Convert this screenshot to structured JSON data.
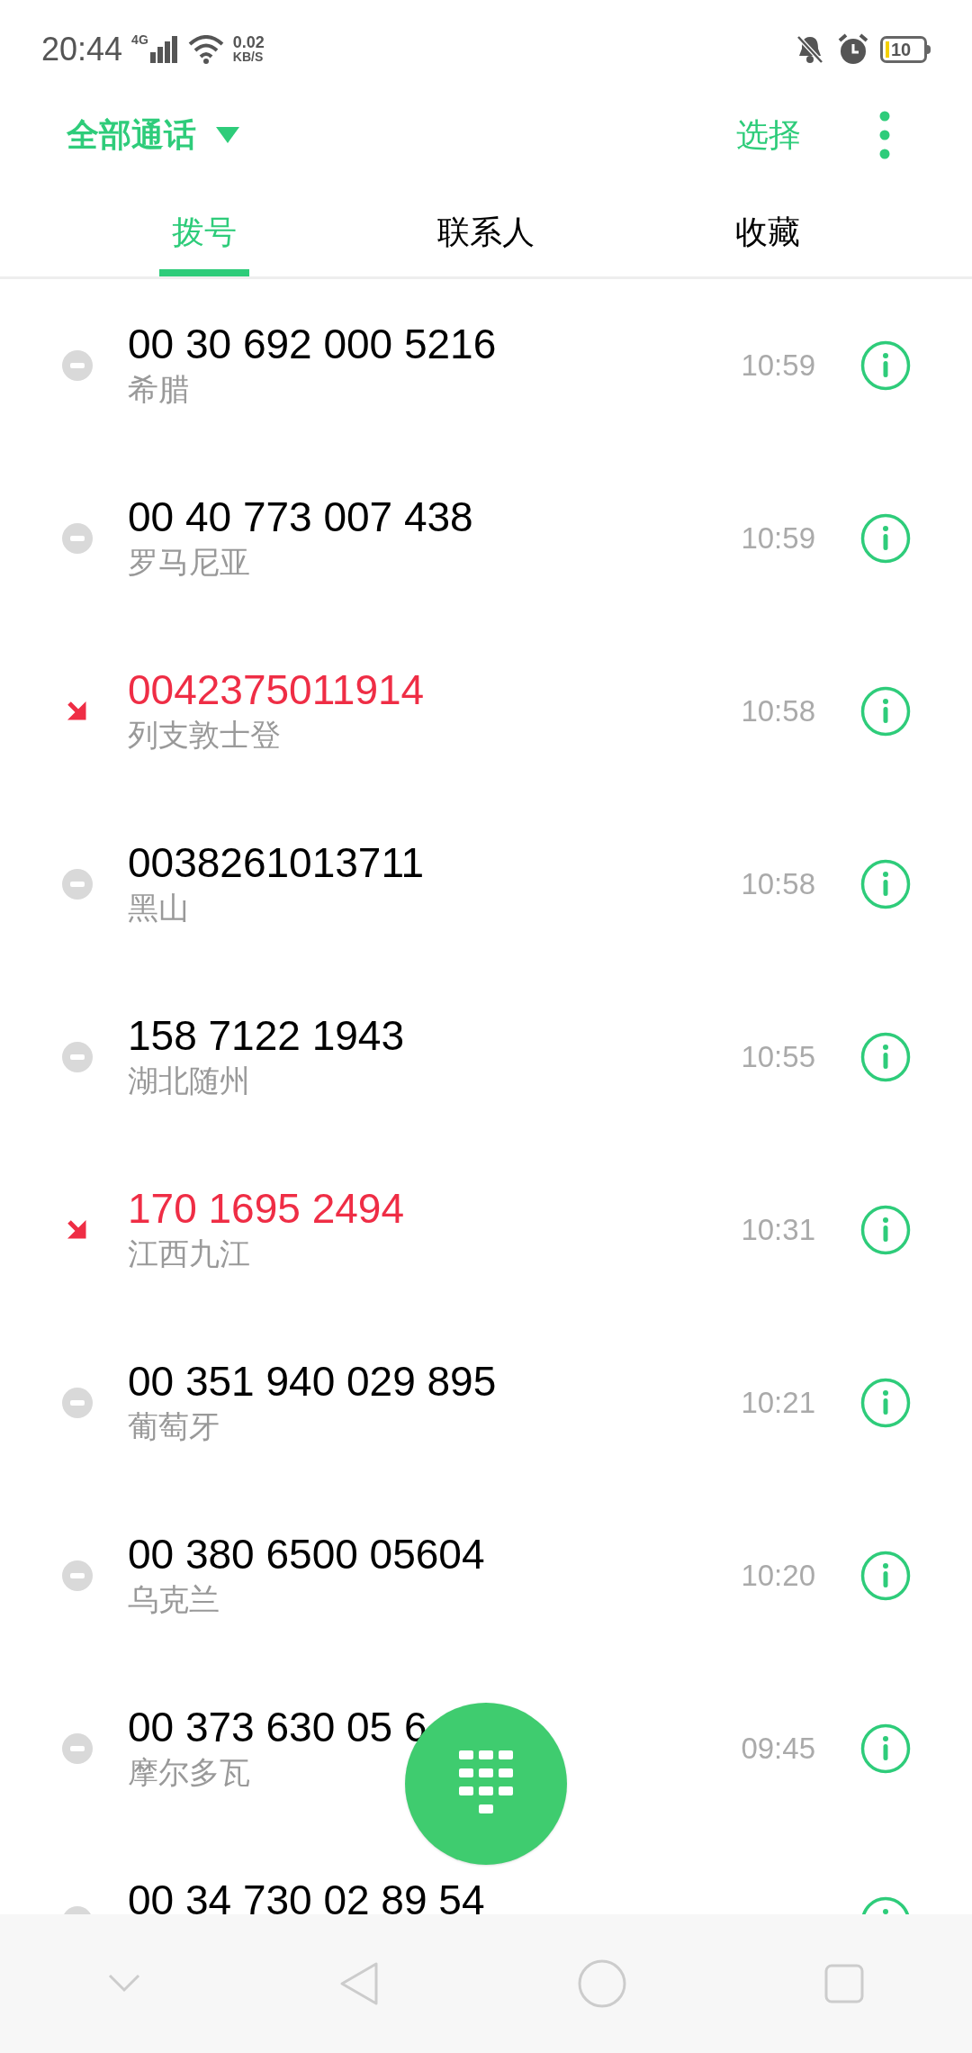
{
  "status_bar": {
    "time": "20:44",
    "network": "4G",
    "speed": "0.02",
    "speed_unit": "KB/S",
    "battery": "10"
  },
  "header": {
    "filter": "全部通话",
    "select": "选择"
  },
  "tabs": [
    {
      "label": "拨号",
      "selected": true
    },
    {
      "label": "联系人",
      "selected": false
    },
    {
      "label": "收藏",
      "selected": false
    }
  ],
  "calls": [
    {
      "kind": "declined",
      "number": "00 30 692 000 5216",
      "location": "希腊",
      "time": "10:59"
    },
    {
      "kind": "declined",
      "number": "00 40 773 007 438",
      "location": "罗马尼亚",
      "time": "10:59"
    },
    {
      "kind": "missed",
      "number": "0042375011914",
      "location": "列支敦士登",
      "time": "10:58"
    },
    {
      "kind": "declined",
      "number": "0038261013711",
      "location": "黑山",
      "time": "10:58"
    },
    {
      "kind": "declined",
      "number": "158 7122 1943",
      "location": "湖北随州",
      "time": "10:55"
    },
    {
      "kind": "missed",
      "number": "170 1695 2494",
      "location": "江西九江",
      "time": "10:31"
    },
    {
      "kind": "declined",
      "number": "00 351 940 029 895",
      "location": "葡萄牙",
      "time": "10:21"
    },
    {
      "kind": "declined",
      "number": "00 380 6500 05604",
      "location": "乌克兰",
      "time": "10:20"
    },
    {
      "kind": "declined",
      "number": "00 373 630 05 6",
      "location": "摩尔多瓦",
      "time": "09:45"
    },
    {
      "kind": "declined",
      "number": "00 34 730 02 89 54"
    }
  ]
}
